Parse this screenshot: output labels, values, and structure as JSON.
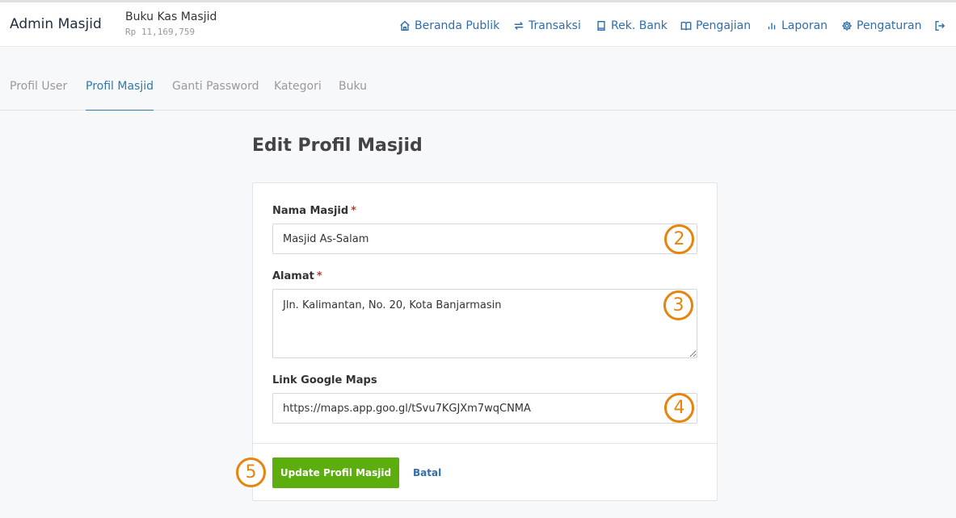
{
  "header": {
    "brand": "Admin Masjid",
    "book_name": "Buku Kas Masjid",
    "book_balance": "Rp 11,169,759",
    "nav": [
      {
        "label": "Beranda Publik",
        "icon": "home-icon"
      },
      {
        "label": "Transaksi",
        "icon": "transfer-icon"
      },
      {
        "label": "Rek. Bank",
        "icon": "book-icon"
      },
      {
        "label": "Pengajian",
        "icon": "open-book-icon"
      },
      {
        "label": "Laporan",
        "icon": "bar-chart-icon"
      },
      {
        "label": "Pengaturan",
        "icon": "gear-icon"
      }
    ],
    "logout_icon": "logout-icon"
  },
  "tabs": [
    {
      "label": "Profil User",
      "active": false
    },
    {
      "label": "Profil Masjid",
      "active": true
    },
    {
      "label": "Ganti Password",
      "active": false
    },
    {
      "label": "Kategori",
      "active": false
    },
    {
      "label": "Buku",
      "active": false
    }
  ],
  "page": {
    "title": "Edit Profil Masjid"
  },
  "form": {
    "nama": {
      "label": "Nama Masjid",
      "required_mark": "*",
      "value": "Masjid As-Salam"
    },
    "alamat": {
      "label": "Alamat",
      "required_mark": "*",
      "value": "Jln. Kalimantan, No. 20, Kota Banjarmasin"
    },
    "maps": {
      "label": "Link Google Maps",
      "value": "https://maps.app.goo.gl/tSvu7KGJXm7wqCNMA"
    },
    "submit_label": "Update Profil Masjid",
    "cancel_label": "Batal"
  },
  "annotations": {
    "m2": "2",
    "m3": "3",
    "m4": "4",
    "m5": "5",
    "color": "#e8830c"
  },
  "colors": {
    "accent": "#2f6eaa",
    "active_tab": "#2f7aa8",
    "submit": "#5cad0e",
    "required": "#c0392b"
  }
}
